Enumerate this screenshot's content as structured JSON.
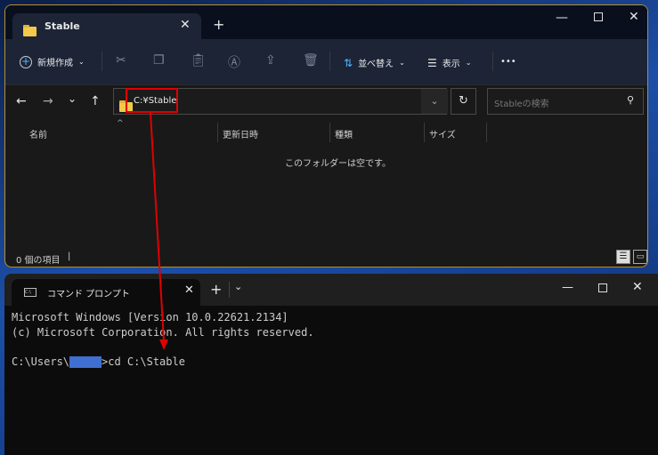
{
  "explorer": {
    "tab_title": "Stable",
    "new_tab": "+",
    "new_label": "新規作成",
    "sort_label": "並べ替え",
    "view_label": "表示",
    "more": "•••",
    "address": "C:¥Stable",
    "search_placeholder": "Stableの検索",
    "columns": [
      "名前",
      "更新日時",
      "種類",
      "サイズ"
    ],
    "empty_message": "このフォルダーは空です。",
    "status": "0 個の項目",
    "status_sep": "|"
  },
  "terminal": {
    "tab_title": "コマンド プロンプト",
    "lines": [
      "Microsoft Windows [Version 10.0.22621.2134]",
      "(c) Microsoft Corporation. All rights reserved."
    ],
    "prompt_prefix": "C:\\Users\\",
    "prompt_command": ">cd C:\\Stable"
  },
  "colors": {
    "annotation": "#e00000",
    "redacted": "#3f6fd0"
  }
}
